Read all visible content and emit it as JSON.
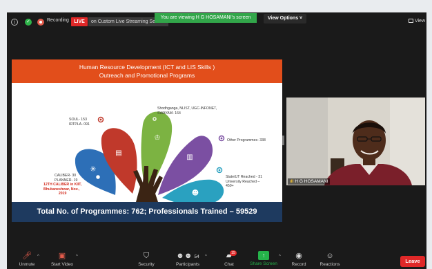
{
  "topbar": {
    "recording_label": "Recording",
    "live_badge": "LIVE",
    "stream_label": "on Custom Live Streaming Service",
    "viewing_banner": "You are viewing H G HOSAMANI's screen",
    "view_options": "View Options ˅",
    "view_label": "View"
  },
  "slide": {
    "title_line1": "Human Resource Development (ICT and LIS Skills )",
    "title_line2": "Outreach and Promotional Programs",
    "soul": "SOUL- 153",
    "irtpla": "IRTPLA- 091",
    "shodh_1": "Shodhganga, NLIST, UGC-INFONET,",
    "shodh_2": "SWAYAM- 164",
    "other": "Other Programmes- 338",
    "caliber": "CALIBER- 30",
    "planner": "PLANNER- 19",
    "caliber_kiit_1": "12TH CALIBER in KIIT,",
    "caliber_kiit_2": "Bhubaneshwar, Nov.,",
    "caliber_kiit_3": "2019",
    "state_1": "State/UT Reached - 31",
    "state_2": "University Reached –",
    "state_3": "450+",
    "footer": "Total No. of Programmes: 762; Professionals Trained – 59529"
  },
  "video": {
    "participant_name": "H G HOSAMANI"
  },
  "toolbar": {
    "unmute": "Unmute",
    "start_video": "Start Video",
    "security": "Security",
    "participants": "Participants",
    "participants_count": "54",
    "chat": "Chat",
    "chat_badge": "15",
    "share_screen": "Share Screen",
    "record": "Record",
    "reactions": "Reactions",
    "leave": "Leave"
  },
  "colors": {
    "zoom_green": "#32a64a",
    "live_red": "#e02828",
    "slide_header": "#e24e1b",
    "slide_footer": "#1e3a5f",
    "petal_blue": "#2d6fb7",
    "petal_red": "#c0392b",
    "petal_green": "#7cb342",
    "petal_purple": "#7b4fa2",
    "petal_teal": "#2aa1c0"
  }
}
